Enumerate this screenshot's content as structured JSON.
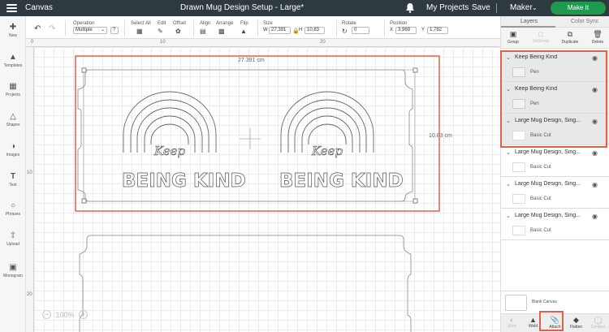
{
  "topbar": {
    "app_label": "Canvas",
    "doc_title": "Drawn Mug Design Setup - Large*",
    "my_projects": "My Projects",
    "save": "Save",
    "machine": "Maker",
    "make_it": "Make It"
  },
  "toolbar": {
    "operation_label": "Operation",
    "operation_value": "Multiple",
    "operation_help": "?",
    "select_all": "Select All",
    "edit": "Edit",
    "offset": "Offset",
    "align": "Align",
    "arrange": "Arrange",
    "flip": "Flip",
    "size": "Size",
    "w_label": "W",
    "w_value": "27,391",
    "h_label": "H",
    "h_value": "10,83",
    "rotate": "Rotate",
    "rotate_value": "0",
    "position": "Position",
    "x_label": "X",
    "x_value": "3,969",
    "y_label": "Y",
    "y_value": "1,782"
  },
  "leftbar": {
    "items": [
      {
        "label": "New",
        "icon": "plus-icon"
      },
      {
        "label": "Templates",
        "icon": "shirt-icon"
      },
      {
        "label": "Projects",
        "icon": "projects-icon"
      },
      {
        "label": "Shapes",
        "icon": "shapes-icon"
      },
      {
        "label": "Images",
        "icon": "lightbulb-icon"
      },
      {
        "label": "Text",
        "icon": "text-icon"
      },
      {
        "label": "Phrases",
        "icon": "speech-bubble-icon"
      },
      {
        "label": "Upload",
        "icon": "upload-icon"
      },
      {
        "label": "Monogram",
        "icon": "monogram-icon"
      }
    ]
  },
  "rulers": {
    "top": [
      "0",
      "10",
      "20"
    ],
    "left": [
      "10",
      "20"
    ]
  },
  "canvas": {
    "width_dim": "27.391 cm",
    "height_dim": "10.83 cm",
    "design_text_script": "Keep",
    "design_text_main": "BEING KIND",
    "zoom": "100%",
    "zoom_minus": "−",
    "zoom_plus": "+"
  },
  "rpanel": {
    "tabs": [
      "Layers",
      "Color Sync"
    ],
    "layer_tools": [
      {
        "label": "Group",
        "icon": "group-icon",
        "disabled": false
      },
      {
        "label": "UnGroup",
        "icon": "ungroup-icon",
        "disabled": true
      },
      {
        "label": "Duplicate",
        "icon": "duplicate-icon",
        "disabled": false
      },
      {
        "label": "Delete",
        "icon": "delete-icon",
        "disabled": false
      }
    ],
    "layers": [
      {
        "name": "Keep Being Kind",
        "op": "Pen",
        "selected": true
      },
      {
        "name": "Keep Being Kind",
        "op": "Pen",
        "selected": true
      },
      {
        "name": "Large Mug Design, Sing...",
        "op": "Basic Cut",
        "selected": true
      },
      {
        "name": "Large Mug Design, Sing...",
        "op": "Basic Cut",
        "selected": false
      },
      {
        "name": "Large Mug Design, Sing...",
        "op": "Basic Cut",
        "selected": false
      },
      {
        "name": "Large Mug Design, Sing...",
        "op": "Basic Cut",
        "selected": false
      }
    ],
    "blank_canvas": "Blank Canvas",
    "bottom_tools": [
      {
        "label": "Slice",
        "icon": "slice-icon",
        "disabled": true
      },
      {
        "label": "Weld",
        "icon": "weld-icon",
        "disabled": false
      },
      {
        "label": "Attach",
        "icon": "attach-icon",
        "disabled": false
      },
      {
        "label": "Flatten",
        "icon": "flatten-icon",
        "disabled": false
      },
      {
        "label": "Contour",
        "icon": "contour-icon",
        "disabled": true
      }
    ]
  },
  "colors": {
    "topbar": "#2f3a40",
    "make_it": "#1e9a4f",
    "highlight": "#e0604a"
  }
}
